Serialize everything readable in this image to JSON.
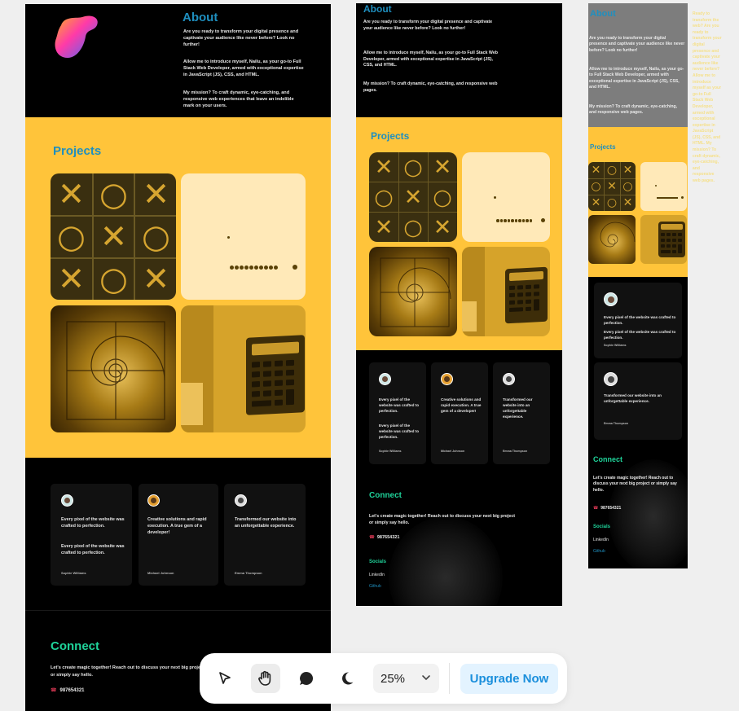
{
  "about": {
    "heading": "About",
    "p1": "Are you ready to transform your digital presence and captivate your audience like never before? Look no further!",
    "p2": "Allow me to introduce myself, Nailu, as your go-to Full Stack Web Developer, armed with exceptional expertise in JavaScript (JS), CSS, and HTML.",
    "p3_desktop": "My mission? To craft dynamic, eye-catching, and responsive web experiences that leave an indelible mark on your users.",
    "p3_tablet": "My mission? To craft dynamic, eye-catching, and responsive web pages."
  },
  "projects": {
    "heading": "Projects"
  },
  "testimonials": [
    {
      "quote": "Every pixel of the website was crafted to perfection.",
      "quote_extra": "Every pixel of the website was crafted to perfection.",
      "name": "Sophie Williams"
    },
    {
      "quote": "Creative solutions and rapid execution. A true gem of a developer!",
      "name": "Michael Johnson"
    },
    {
      "quote": "Transformed our website into an unforgettable experience.",
      "name": "Emma Thompson"
    }
  ],
  "connect": {
    "heading": "Connect",
    "text": "Let's create magic together! Reach out to discuss your next big project or simply say hello.",
    "phone": "987654321",
    "socials_heading": "Socials",
    "linkedin": "LinkedIn",
    "github": "Github"
  },
  "mobile_side_text": "Ready to transform the web? Are you ready to transform your digital presence and captivate your audience like never before? Allow me to introduce myself as your go-to Full Stack Web Developer, armed with exceptional expertise in JavaScript (JS), CSS, and HTML. My mission? To craft dynamic, eye-catching, and responsive web pages.",
  "toolbar": {
    "zoom": "25%",
    "upgrade_label": "Upgrade Now"
  },
  "colors": {
    "yellow": "#ffc43a",
    "about_heading": "#1f8fbf",
    "connect_heading": "#1fd39a",
    "upgrade_text": "#1b8fdc"
  }
}
